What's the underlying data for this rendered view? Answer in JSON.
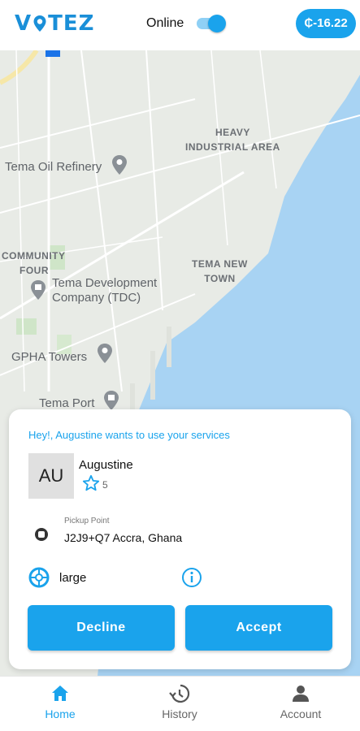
{
  "header": {
    "logo_text_1": "V",
    "logo_text_2": "TEZ",
    "online_label": "Online",
    "online_toggle_on": true,
    "balance": "₵-16.22"
  },
  "map": {
    "labels": {
      "heavy_industrial_1": "HEAVY",
      "heavy_industrial_2": "INDUSTRIAL AREA",
      "tema_oil_refinery": "Tema Oil Refinery",
      "community_four_1": "COMMUNITY",
      "community_four_2": "FOUR",
      "tema_development_1": "Tema Development",
      "tema_development_2": "Company (TDC)",
      "tema_new_town_1": "TEMA NEW",
      "tema_new_town_2": "TOWN",
      "gpha_towers": "GPHA Towers",
      "tema_port": "Tema Port"
    }
  },
  "request_card": {
    "title": "Hey!, Augustine wants to use your services",
    "avatar_initials": "AU",
    "customer_name": "Augustine",
    "rating": "5",
    "pickup_label": "Pickup Point",
    "pickup_value": "J2J9+Q7 Accra, Ghana",
    "size": "large",
    "decline_label": "Decline",
    "accept_label": "Accept"
  },
  "bottom_nav": {
    "items": [
      {
        "label": "Home",
        "active": true
      },
      {
        "label": "History",
        "active": false
      },
      {
        "label": "Account",
        "active": false
      }
    ]
  },
  "colors": {
    "accent": "#1aa3ec",
    "map_land": "#e8ebe6",
    "map_water": "#a8d3f3"
  }
}
